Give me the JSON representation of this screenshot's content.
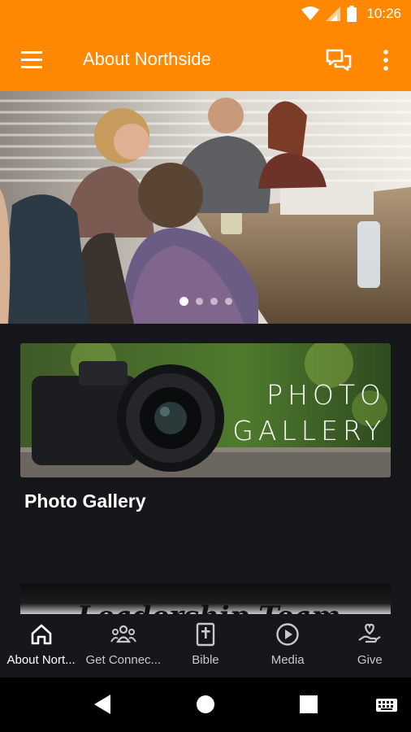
{
  "status_bar": {
    "time": "10:26"
  },
  "app_bar": {
    "title": "About Northside"
  },
  "hero": {
    "slide_count": 4,
    "active_slide": 1
  },
  "gallery": {
    "image_line1": "PHOTO",
    "image_line2": "GALLERY",
    "caption": "Photo Gallery"
  },
  "leadership": {
    "image_text": "Leadership Team"
  },
  "bottom_nav": {
    "items": [
      {
        "label": "About Nort...",
        "icon": "home-icon",
        "active": true
      },
      {
        "label": "Get Connec...",
        "icon": "group-icon",
        "active": false
      },
      {
        "label": "Bible",
        "icon": "bible-icon",
        "active": false
      },
      {
        "label": "Media",
        "icon": "play-circle-icon",
        "active": false
      },
      {
        "label": "Give",
        "icon": "give-heart-icon",
        "active": false
      }
    ]
  },
  "colors": {
    "accent": "#ff8800",
    "background": "#15171a"
  }
}
